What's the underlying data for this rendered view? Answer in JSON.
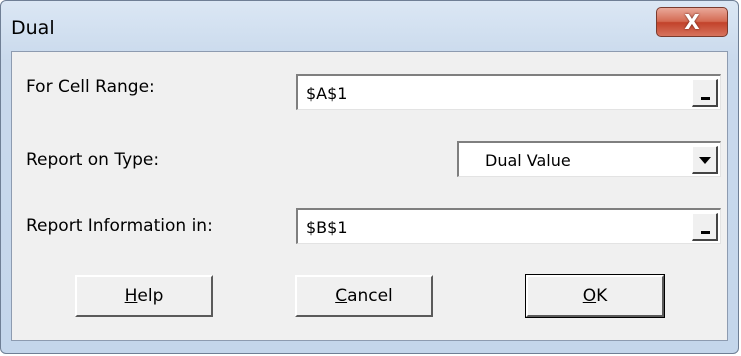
{
  "window": {
    "title": "Dual",
    "close_glyph": "X"
  },
  "cell_range": {
    "label": "For Cell Range:",
    "value": "$A$1"
  },
  "report_type": {
    "label": "Report on Type:",
    "selected": "Dual Value"
  },
  "report_info": {
    "label": "Report Information in:",
    "value": "$B$1"
  },
  "buttons": {
    "help": {
      "mnemonic": "H",
      "rest": "elp"
    },
    "cancel": {
      "mnemonic": "C",
      "rest": "ancel"
    },
    "ok": {
      "mnemonic": "O",
      "rest": "K"
    }
  },
  "icons": [
    "close-icon",
    "collapse-range-icon",
    "dropdown-arrow-icon"
  ]
}
